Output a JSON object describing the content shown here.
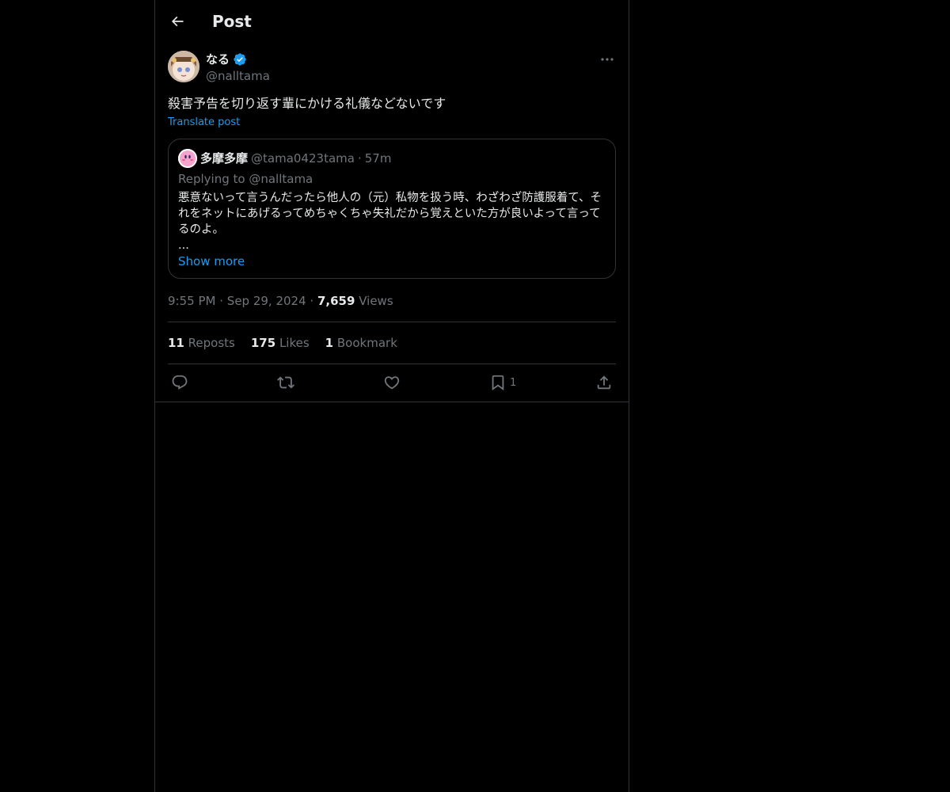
{
  "header": {
    "title": "Post"
  },
  "post": {
    "author_name": "なる",
    "author_handle": "@nalltama",
    "text": "殺害予告を切り返す輩にかける礼儀などないです",
    "translate_label": "Translate post",
    "quote": {
      "name": "多摩多摩",
      "handle": "@tama0423tama",
      "separator": "·",
      "time": "57m",
      "replying_to": "Replying to @nalltama",
      "text": "悪意ないって言うんだったら他人の（元）私物を扱う時、わざわざ防護服着て、それをネットにあげるってめちゃくちゃ失礼だから覚えといた方が良いよって言ってるのよ。",
      "ellipsis": "...",
      "show_more": "Show more"
    },
    "meta": {
      "time": "9:55 PM",
      "separator": "·",
      "date": "Sep 29, 2024",
      "views_count": "7,659",
      "views_label": "Views"
    },
    "stats": {
      "reposts_count": "11",
      "reposts_label": "Reposts",
      "likes_count": "175",
      "likes_label": "Likes",
      "bookmarks_count": "1",
      "bookmarks_label": "Bookmark"
    },
    "actions": {
      "bookmark_count": "1"
    }
  },
  "colors": {
    "background": "#000000",
    "text": "#e7e9ea",
    "muted": "#71767b",
    "link": "#1d9bf0",
    "border": "#2f3336",
    "verified": "#1d9bf0"
  },
  "icons": [
    "back-arrow-icon",
    "verified-badge-icon",
    "more-icon",
    "reply-icon",
    "repost-icon",
    "like-icon",
    "bookmark-icon",
    "share-icon"
  ]
}
